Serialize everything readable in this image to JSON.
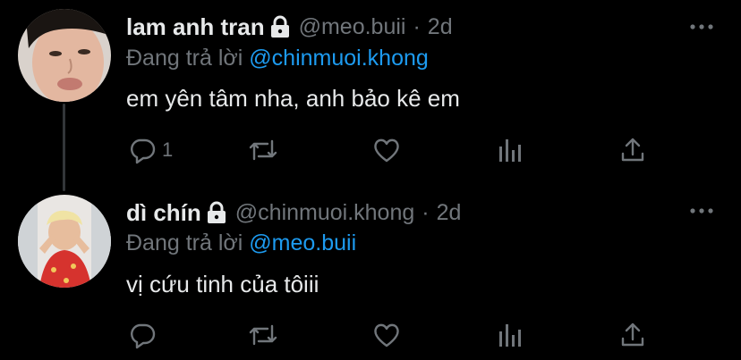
{
  "tweets": [
    {
      "display_name": "lam anh tran",
      "handle": "@meo.buii",
      "separator": "·",
      "timestamp": "2d",
      "replying_prefix": "Đang trả lời",
      "replying_to": "@chinmuoi.khong",
      "text": "em yên tâm nha, anh bảo kê em",
      "reply_count": "1"
    },
    {
      "display_name": "dì chín",
      "handle": "@chinmuoi.khong",
      "separator": "·",
      "timestamp": "2d",
      "replying_prefix": "Đang trả lời",
      "replying_to": "@meo.buii",
      "text": "vị cứu tinh của tôiii",
      "reply_count": ""
    }
  ],
  "icons": {
    "lock": "lock-icon",
    "more": "more-icon",
    "reply": "reply-icon",
    "retweet": "retweet-icon",
    "like": "heart-icon",
    "analytics": "analytics-icon",
    "share": "share-icon"
  },
  "colors": {
    "background": "#000000",
    "primary_text": "#e7e9ea",
    "secondary_text": "#71767b",
    "mention": "#1d9bf0"
  }
}
